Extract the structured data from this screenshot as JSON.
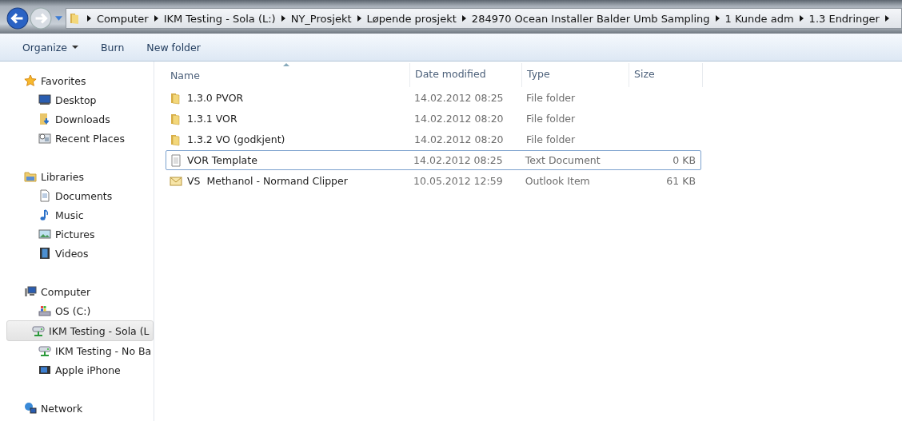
{
  "address_bar": {
    "segments": [
      "Computer",
      "IKM Testing - Sola (L:)",
      "NY_Prosjekt",
      "Løpende prosjekt",
      "284970 Ocean Installer Balder Umb Sampling",
      "1 Kunde adm",
      "1.3 Endringer"
    ]
  },
  "toolbar": {
    "organize": "Organize",
    "buttons": [
      "Burn",
      "New folder"
    ]
  },
  "sidebar": {
    "groups": [
      {
        "label": "Favorites",
        "kind": "star",
        "items": [
          {
            "label": "Desktop",
            "kind": "desktop",
            "selected": false
          },
          {
            "label": "Downloads",
            "kind": "downloads",
            "selected": false
          },
          {
            "label": "Recent Places",
            "kind": "recent",
            "selected": false
          }
        ]
      },
      {
        "label": "Libraries",
        "kind": "libraries",
        "items": [
          {
            "label": "Documents",
            "kind": "document",
            "selected": false
          },
          {
            "label": "Music",
            "kind": "music",
            "selected": false
          },
          {
            "label": "Pictures",
            "kind": "pictures",
            "selected": false
          },
          {
            "label": "Videos",
            "kind": "videos",
            "selected": false
          }
        ]
      },
      {
        "label": "Computer",
        "kind": "computer",
        "items": [
          {
            "label": "OS (C:)",
            "kind": "drive",
            "selected": false
          },
          {
            "label": "IKM Testing - Sola (L",
            "kind": "network-drive",
            "selected": true
          },
          {
            "label": "IKM Testing - No Ba",
            "kind": "network-drive",
            "selected": false
          },
          {
            "label": "Apple iPhone",
            "kind": "phone",
            "selected": false
          }
        ]
      },
      {
        "label": "Network",
        "kind": "network"
      }
    ]
  },
  "table": {
    "columns": [
      "Name",
      "Date modified",
      "Type",
      "Size"
    ],
    "rows": [
      {
        "kind": "folder",
        "name": "1.3.0 PVOR",
        "date": "14.02.2012 08:25",
        "type": "File folder",
        "focused": false
      },
      {
        "kind": "folder",
        "name": "1.3.1 VOR",
        "date": "14.02.2012 08:20",
        "type": "File folder",
        "focused": false
      },
      {
        "kind": "folder",
        "name": "1.3.2 VO (godkjent)",
        "date": "14.02.2012 08:20",
        "type": "File folder",
        "focused": false
      },
      {
        "kind": "text",
        "name": "VOR Template",
        "date": "14.02.2012 08:25",
        "type": "Text Document",
        "size": "0 KB",
        "focused": true
      },
      {
        "kind": "mail",
        "name": "VS  Methanol - Normand Clipper",
        "date": "10.05.2012 12:59",
        "type": "Outlook Item",
        "size": "61 KB",
        "focused": false
      }
    ]
  }
}
